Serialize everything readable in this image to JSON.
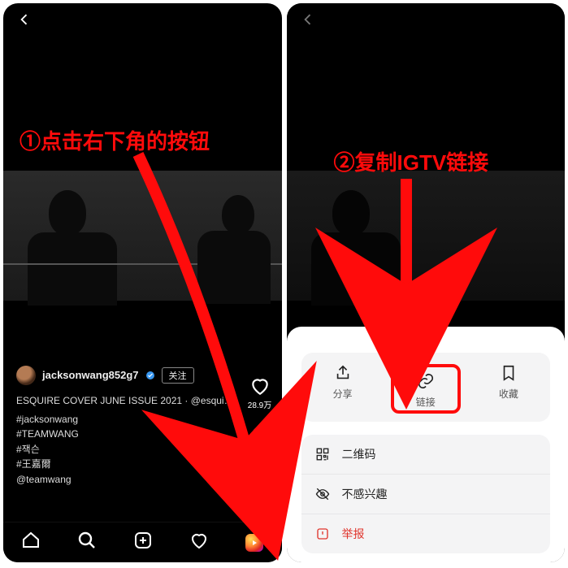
{
  "annotations": {
    "step1": "①点击右下角的按钮",
    "step2": "②复制IGTV链接"
  },
  "screen1": {
    "user": {
      "username": "jacksonwang852g7",
      "follow_label": "关注"
    },
    "caption_line": "ESQUIRE COVER JUNE ISSUE 2021 · @esqui…",
    "tags": [
      "#jacksonwang",
      "#TEAMWANG",
      "#잭슨",
      "#王嘉爾",
      "@teamwang"
    ],
    "like_count": "28.9万"
  },
  "screen2": {
    "actions": {
      "share": "分享",
      "link": "链接",
      "save": "收藏"
    },
    "menu": {
      "qrcode": "二维码",
      "not_interested": "不感兴趣",
      "report": "举报"
    }
  }
}
